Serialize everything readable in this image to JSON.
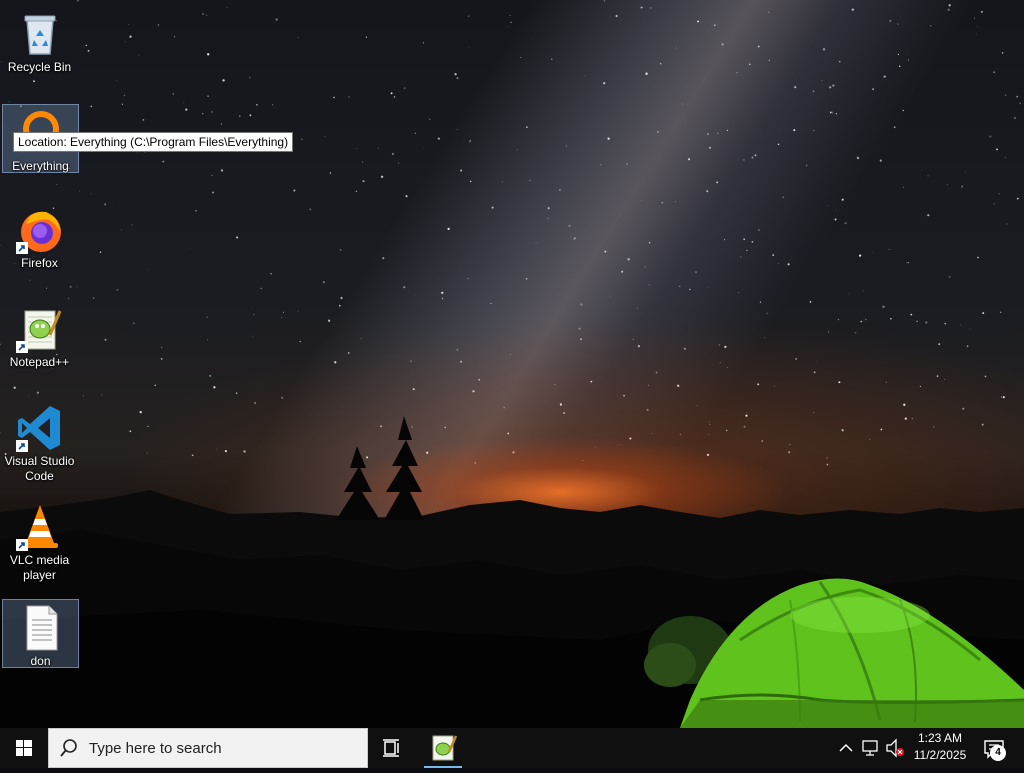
{
  "desktop": {
    "icons": [
      {
        "label": "Recycle Bin",
        "icon": "recycle-bin-icon",
        "selected": false
      },
      {
        "label": "Everything",
        "icon": "everything-icon",
        "selected": true
      },
      {
        "label": "Firefox",
        "icon": "firefox-icon",
        "selected": false
      },
      {
        "label": "Notepad++",
        "icon": "notepad-plus-plus-icon",
        "selected": false
      },
      {
        "label": "Visual Studio Code",
        "icon": "vscode-icon",
        "selected": false
      },
      {
        "label": "VLC media player",
        "icon": "vlc-icon",
        "selected": false
      },
      {
        "label": "don",
        "icon": "text-file-icon",
        "selected": true
      }
    ],
    "tooltip": "Location: Everything (C:\\Program Files\\Everything)"
  },
  "taskbar": {
    "search_placeholder": "Type here to search",
    "clock_time": "1:23 AM",
    "clock_date": "11/2/2025",
    "notification_count": "4",
    "accent": "#76b9ed"
  }
}
